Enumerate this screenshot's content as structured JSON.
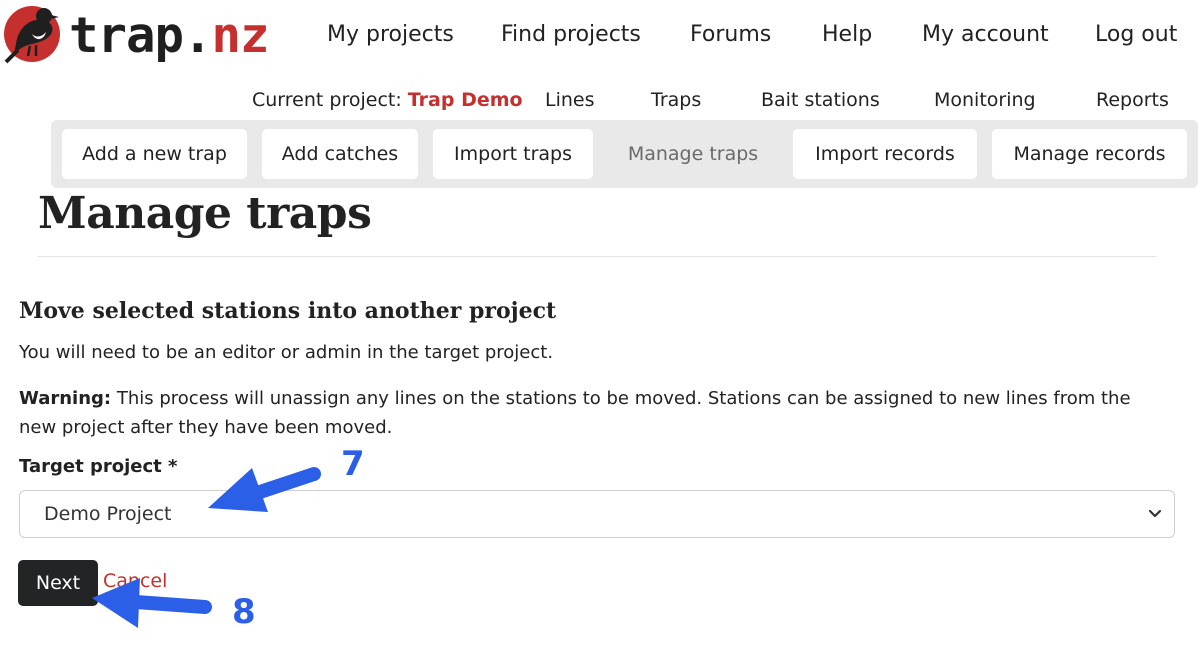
{
  "logo": {
    "part1": "trap.",
    "part2": "nz",
    "icon": "bird-logo-icon"
  },
  "topnav": [
    "My projects",
    "Find projects",
    "Forums",
    "Help",
    "My account",
    "Log out"
  ],
  "subnav": {
    "current_label": "Current project:",
    "current_project": "Trap Demo",
    "items": [
      "Lines",
      "Traps",
      "Bait stations",
      "Monitoring",
      "Reports"
    ]
  },
  "tabs": [
    "Add a new trap",
    "Add catches",
    "Import traps",
    "Manage traps",
    "Import records",
    "Manage records"
  ],
  "active_tab": "Manage traps",
  "page_title": "Manage traps",
  "section": {
    "heading": "Move selected stations into another project",
    "intro": "You will need to be an editor or admin in the target project.",
    "warning_label": "Warning:",
    "warning_text": "This process will unassign any lines on the stations to be moved. Stations can be assigned to new lines from the new project after they have been moved."
  },
  "form": {
    "target_label": "Target project *",
    "target_value": "Demo Project",
    "next_label": "Next",
    "cancel_label": "Cancel"
  },
  "annotations": {
    "step7": "7",
    "step8": "8"
  },
  "colors": {
    "brand_red": "#c5302f",
    "annotation_blue": "#2b5fe8",
    "button_dark": "#222426",
    "tabbar_bg": "#e9e9e9"
  }
}
